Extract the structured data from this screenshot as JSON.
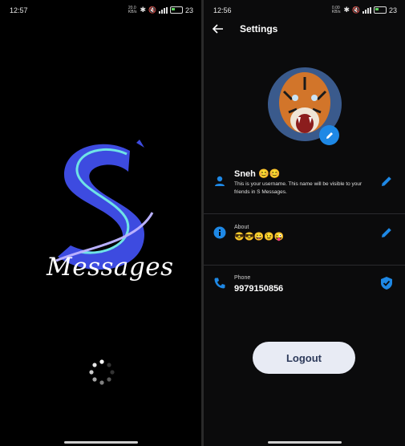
{
  "left": {
    "status": {
      "time": "12:57",
      "net_top": "20.0",
      "net_bottom": "KB/s",
      "battery": "23"
    },
    "app_name": "Messages"
  },
  "right": {
    "status": {
      "time": "12:56",
      "net_top": "0.00",
      "net_bottom": "KB/s",
      "battery": "23"
    },
    "title": "Settings",
    "profile": {
      "name": "Sneh 😊😊",
      "name_desc": "This is your username. This name will be visible to your friends in S Messages."
    },
    "about": {
      "label": "About",
      "value": "😎😎😀😉😜"
    },
    "phone": {
      "label": "Phone",
      "value": "9979150856"
    },
    "logout_label": "Logout"
  },
  "colors": {
    "accent": "#1e88e5",
    "logo_blue": "#3d4be0",
    "logo_cyan": "#6fe3e6"
  }
}
